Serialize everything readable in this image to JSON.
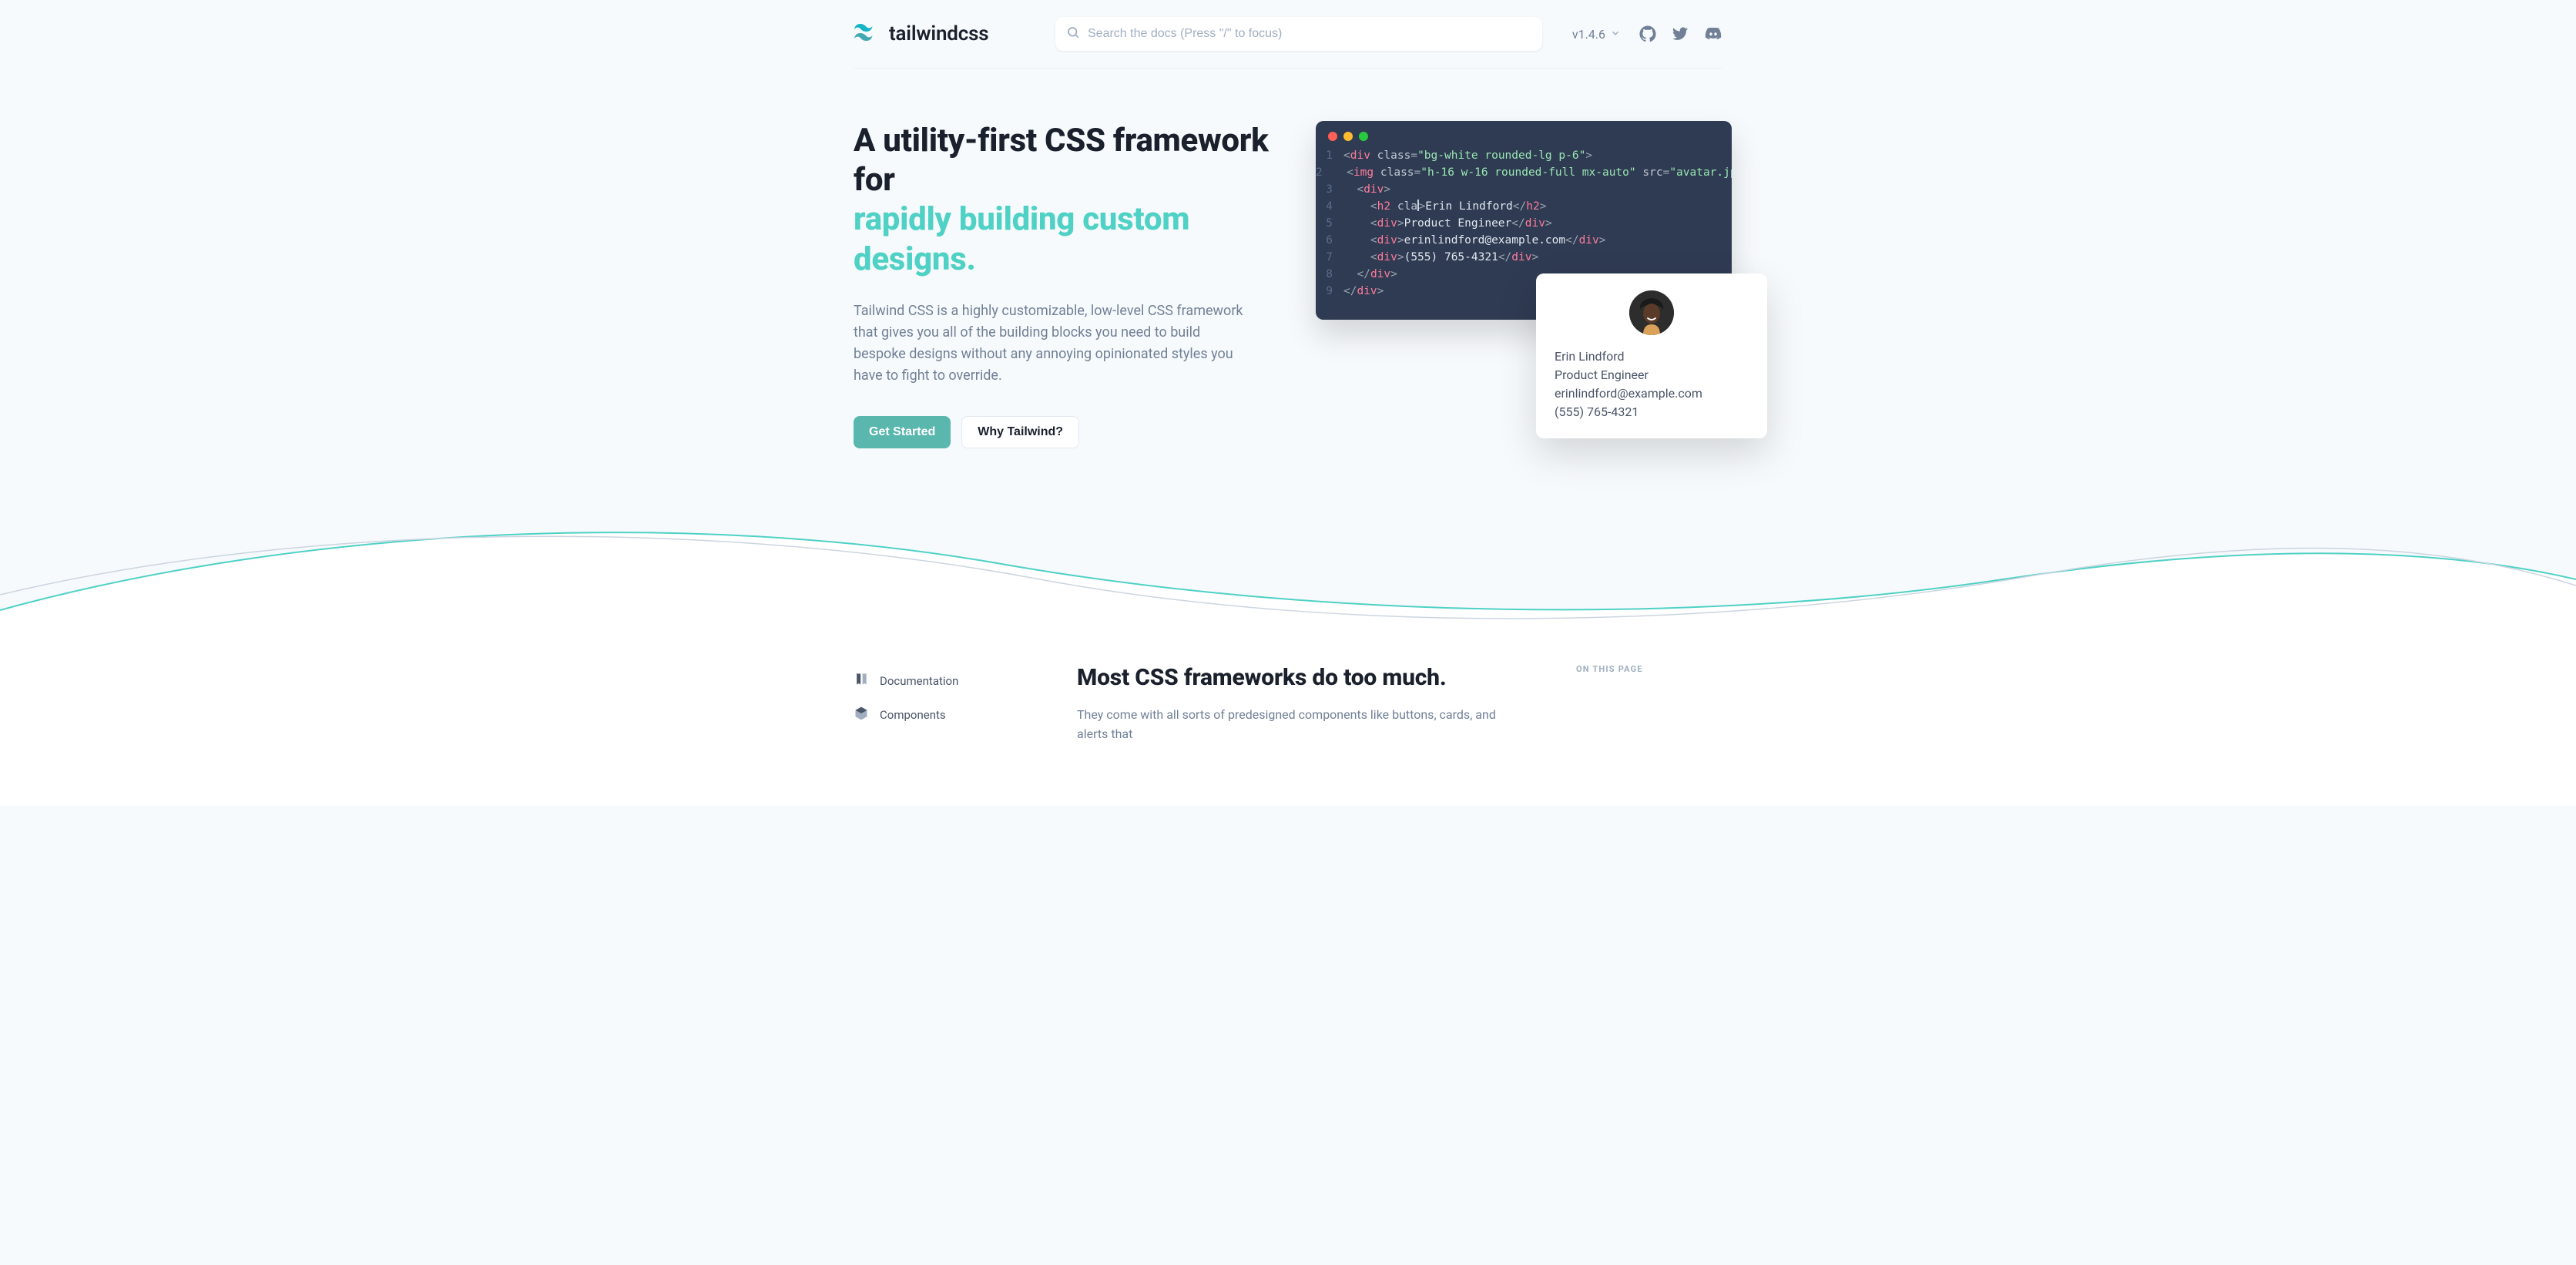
{
  "header": {
    "brand": "tailwindcss",
    "search_placeholder": "Search the docs (Press \"/\" to focus)",
    "version": "v1.4.6"
  },
  "hero": {
    "title_line1": "A utility-first CSS framework for",
    "title_line2": "rapidly building custom designs.",
    "subtitle": "Tailwind CSS is a highly customizable, low-level CSS framework that gives you all of the building blocks you need to build bespoke designs without any annoying opinionated styles you have to fight to override.",
    "cta_primary": "Get Started",
    "cta_secondary": "Why Tailwind?"
  },
  "code": {
    "l1_class": "bg-white rounded-lg p-6",
    "l2_class": "h-16 w-16 rounded-full mx-auto",
    "l2_src": "avatar.jpg",
    "l4_attr_partial": "cla",
    "l4_text": "Erin Lindford",
    "l5_text": "Product Engineer",
    "l6_text": "erinlindford@example.com",
    "l7_text": "(555) 765-4321"
  },
  "card": {
    "name": "Erin Lindford",
    "role": "Product Engineer",
    "email": "erinlindford@example.com",
    "phone": "(555) 765-4321"
  },
  "sidenav": {
    "item1": "Documentation",
    "item2": "Components"
  },
  "below": {
    "heading": "Most CSS frameworks do too much.",
    "para_partial": "They come with all sorts of predesigned components like buttons, cards, and alerts that",
    "toc_title": "ON THIS PAGE"
  }
}
